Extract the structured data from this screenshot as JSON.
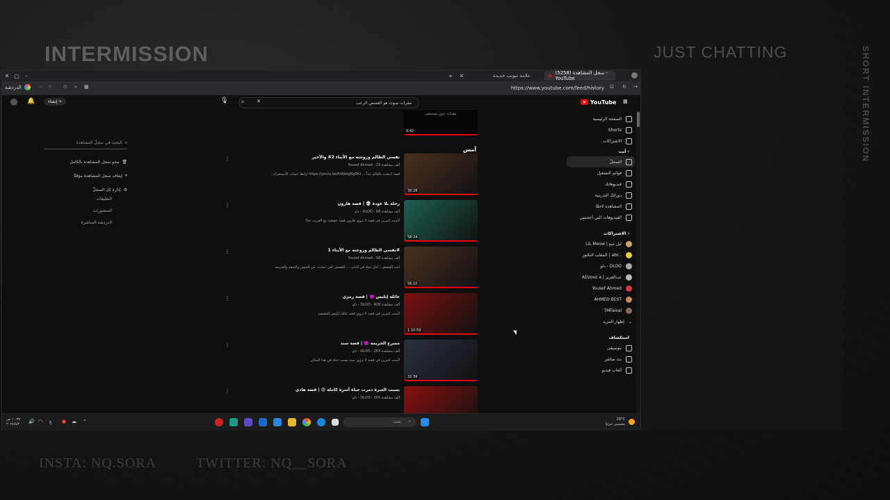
{
  "overlay": {
    "intermission": "INTERMISSION",
    "just_chatting": "JUST CHATTING",
    "short_intermission": "SHORT INTERMISSION",
    "insta": "INSTA: NQ.SORA",
    "twitter": "TWITTER: NQ__SORA"
  },
  "browser": {
    "tabs": [
      {
        "label": "علامة تبويب جديدة"
      },
      {
        "label": "(5258) سجل المشاهدة - YouTube"
      }
    ],
    "address": "https://www.youtube.com/feed/history",
    "profile_label": "الدردشة"
  },
  "youtube": {
    "logo_text": "YouTube",
    "search_value": "مقرات صوت هو القصص الرعب",
    "create_label": "إنشاء",
    "section_day": "أمس",
    "top_video": {
      "duration": "0:42",
      "caption": "مقرات بدون موسيقى"
    },
    "sidebar": {
      "main": [
        {
          "label": "الصفحة الرئيسية",
          "icon": "home-icon"
        },
        {
          "label": "Shorts",
          "icon": "shorts-icon"
        },
        {
          "label": "الاشتراكات",
          "icon": "subscriptions-icon"
        }
      ],
      "you_header": "أنت",
      "you": [
        {
          "label": "السجلّ",
          "icon": "history-icon",
          "active": true
        },
        {
          "label": "قوائم التشغيل",
          "icon": "playlist-icon"
        },
        {
          "label": "فيديوهاتك",
          "icon": "video-icon"
        },
        {
          "label": "دوراتك التدريبية",
          "icon": "course-icon"
        },
        {
          "label": "المشاهدة لاحقًا",
          "icon": "clock-icon"
        },
        {
          "label": "الفيديوهات التي أعجبتني",
          "icon": "like-icon"
        }
      ],
      "subs_header": "الاشتراكات",
      "subs": [
        {
          "label": "LiL Meow | ليل ميو",
          "color": "#c8a86a"
        },
        {
          "label": "المقلب التكنوز | abc..",
          "color": "#e0d040"
        },
        {
          "label": "دلو - DLOO",
          "color": "#aaaaaa"
        },
        {
          "label": "ADzooz a | عبدالعزيز",
          "color": "#bbbbbb"
        },
        {
          "label": "Yousef Ahmed",
          "color": "#cc3a3a"
        },
        {
          "label": "AHMED BEST",
          "color": "#c98a5a"
        },
        {
          "label": "TMFaisal",
          "color": "#8a6a5a"
        }
      ],
      "show_more": "إظهار المزيد",
      "explore_header": "استكشاف",
      "explore": [
        {
          "label": "موسيقى",
          "icon": "music-icon"
        },
        {
          "label": "بث مباشر",
          "icon": "live-icon"
        },
        {
          "label": "ألعاب فيديو",
          "icon": "gaming-icon"
        }
      ]
    },
    "history_panel": {
      "search_placeholder": "البحث في سجلّ المشاهدة",
      "clear_all": "محو سجل المشاهدة بالكامل",
      "pause": "إيقاف سجل المشاهدة مؤقتًا",
      "manage": "إدارة كل السجلّ",
      "comments": "التعليقات",
      "posts": "المنشورات",
      "live_chat": "الدردشة المباشرة"
    },
    "videos": [
      {
        "title": "نفسي الظالم وزوجته مع الأبناء 2# والأخير",
        "meta": "Yousef Ahmed - 23 ألف مشاهدة",
        "desc": "ارابط حساب الأنستغرام ؛ https://youtu.be/HdVeIgNg9lU ... قصة انتشت بالعالم جداً",
        "duration": "30:28",
        "bg": "#4a3020"
      },
      {
        "title": "رحلة بلا عودة 💀 | قصة هارون",
        "meta": "دلو - DLOO - 68 ألف مشاهدة",
        "desc": "لأمنت كثيرين في قصة لا تروي هارون قصة حقيقية مع الغريب جدًا",
        "duration": "58:34",
        "bg": "#1d6050"
      },
      {
        "title": "نفسي الظالم وزوجته مع الأبناء 1#",
        "meta": "Yousef Ahmed - 58 ألف مشاهدة",
        "desc": "انتبه القصص ؛ اجل حياة في التاني ... القصص التي تتحدث عن الخوف والمتعة والجريمة",
        "duration": "56:10",
        "bg": "#4a3020"
      },
      {
        "title": "عائلة إبليس 👿 | قصة رمزي",
        "meta": "دلو - DLOO - 428 ألف مشاهدة",
        "desc": "لأمنت كثيرين في قصة لا تروي قصة عائلة إبليس الحقيقية",
        "duration": "1:10:59",
        "bg": "#7a1010"
      },
      {
        "title": "مسرح الجريمة 👿 | قصة سند",
        "meta": "دلو - DLOO - 283 ألف مشاهدة",
        "desc": "لأمنت كثيرين في قصة لا تروي سند بسبب حياة في هذا المكان",
        "duration": "32:39",
        "bg": "#2a3040"
      },
      {
        "title": "بسبب الغيرة دمرت حياة أسرة كاملة 😡 | قصة هادي",
        "meta": "دلو - DLOO - 305 ألف مشاهدة",
        "desc": "",
        "duration": "",
        "bg": "#8a1010"
      }
    ]
  },
  "taskbar": {
    "search_label": "بحث",
    "time": "١٠:٣٧ ص",
    "date": "٢٠٢٤/٥/٢",
    "temp": "28°C",
    "weather": "مشمس جزئيًا",
    "lang": "ع"
  }
}
